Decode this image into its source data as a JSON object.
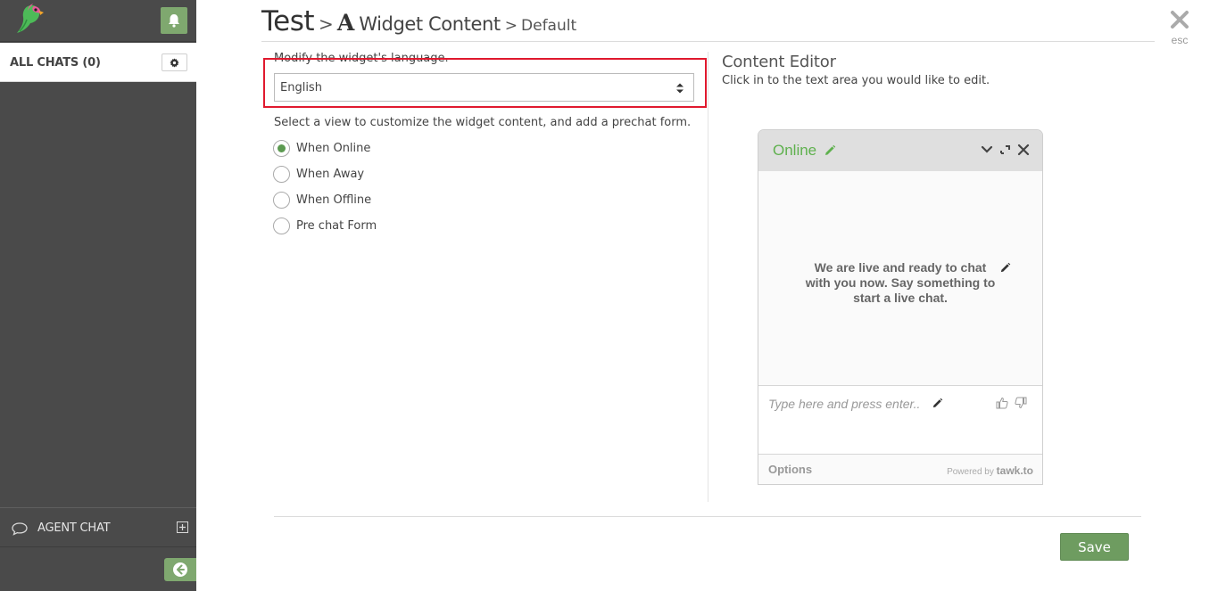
{
  "sidebar": {
    "all_chats_label": "ALL CHATS (0)",
    "agent_chat_label": "AGENT CHAT"
  },
  "header": {
    "title": "Test",
    "separator": ">",
    "section_glyph": "A",
    "section": "Widget Content",
    "subsection": "Default",
    "close_label": "esc"
  },
  "form": {
    "language_label": "Modify the widget's language.",
    "language_value": "English",
    "view_label": "Select a view to customize the widget content, and add a prechat form.",
    "views": [
      {
        "label": "When Online",
        "checked": true
      },
      {
        "label": "When Away",
        "checked": false
      },
      {
        "label": "When Offline",
        "checked": false
      },
      {
        "label": "Pre chat Form",
        "checked": false
      }
    ]
  },
  "content_editor": {
    "title": "Content Editor",
    "subtitle": "Click in to the text area you would like to edit.",
    "widget": {
      "status": "Online",
      "message": "We are live and ready to chat with you now. Say something to start a live chat.",
      "input_placeholder": "Type here and press enter..",
      "options_label": "Options",
      "powered_by": "Powered by",
      "brand": "tawk.to"
    }
  },
  "actions": {
    "save_label": "Save"
  },
  "colors": {
    "sidebar_bg": "#4a4a4a",
    "accent_green": "#7fa86f",
    "status_green": "#5fb14e",
    "highlight_red": "#e0192e"
  }
}
